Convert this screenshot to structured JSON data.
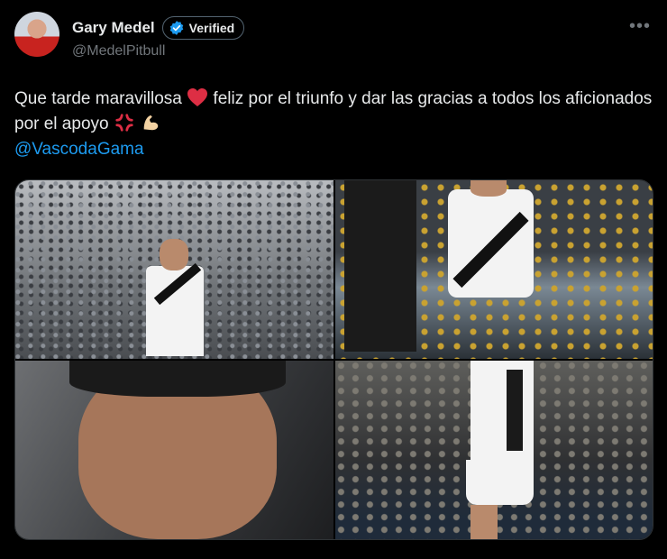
{
  "author": {
    "name": "Gary Medel",
    "verified_label": "Verified",
    "handle": "@MedelPitbull"
  },
  "tweet": {
    "text_part1": "Que tarde maravillosa ",
    "text_part2": " feliz por el triunfo y dar las gracias a todos los aficionados por el apoyo ",
    "mention": "@VascodaGama"
  },
  "icons": {
    "more": "more-icon",
    "verified": "verified-badge-icon",
    "heart": "red-heart-emoji",
    "anger": "anger-symbol-emoji",
    "muscle": "flexed-biceps-emoji"
  },
  "colors": {
    "background": "#000000",
    "text": "#e7e9ea",
    "secondary": "#71767b",
    "link": "#1d9bf0",
    "verified": "#1d9bf0"
  }
}
